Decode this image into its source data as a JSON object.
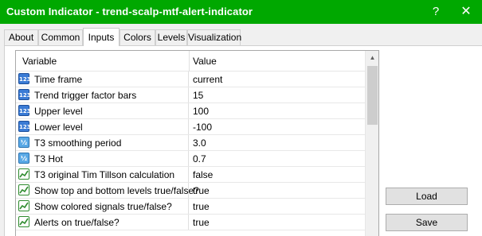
{
  "window": {
    "title": "Custom Indicator - trend-scalp-mtf-alert-indicator",
    "help_glyph": "?",
    "close_glyph": "✕"
  },
  "tabs": [
    {
      "label": "About"
    },
    {
      "label": "Common"
    },
    {
      "label": "Inputs"
    },
    {
      "label": "Colors"
    },
    {
      "label": "Levels"
    },
    {
      "label": "Visualization"
    }
  ],
  "active_tab": "Inputs",
  "grid": {
    "headers": {
      "variable": "Variable",
      "value": "Value"
    },
    "rows": [
      {
        "icon": "integer-icon",
        "icon_text": "123",
        "name": "Time frame",
        "value": "current"
      },
      {
        "icon": "integer-icon",
        "icon_text": "123",
        "name": "Trend trigger factor bars",
        "value": "15"
      },
      {
        "icon": "integer-icon",
        "icon_text": "123",
        "name": "Upper level",
        "value": "100"
      },
      {
        "icon": "integer-icon",
        "icon_text": "123",
        "name": "Lower level",
        "value": "-100"
      },
      {
        "icon": "double-icon",
        "icon_text": "½",
        "name": "T3 smoothing period",
        "value": "3.0"
      },
      {
        "icon": "double-icon",
        "icon_text": "½",
        "name": "T3 Hot",
        "value": "0.7"
      },
      {
        "icon": "boolean-icon",
        "icon_text": "",
        "name": "T3 original Tim Tillson calculation",
        "value": "false"
      },
      {
        "icon": "boolean-icon",
        "icon_text": "",
        "name": "Show top and bottom levels true/false?",
        "value": "true"
      },
      {
        "icon": "boolean-icon",
        "icon_text": "",
        "name": "Show colored signals true/false?",
        "value": "true"
      },
      {
        "icon": "boolean-icon",
        "icon_text": "",
        "name": "Alerts on true/false?",
        "value": "true"
      }
    ],
    "scroll_up_glyph": "▲"
  },
  "buttons": {
    "load": "Load",
    "save": "Save"
  }
}
